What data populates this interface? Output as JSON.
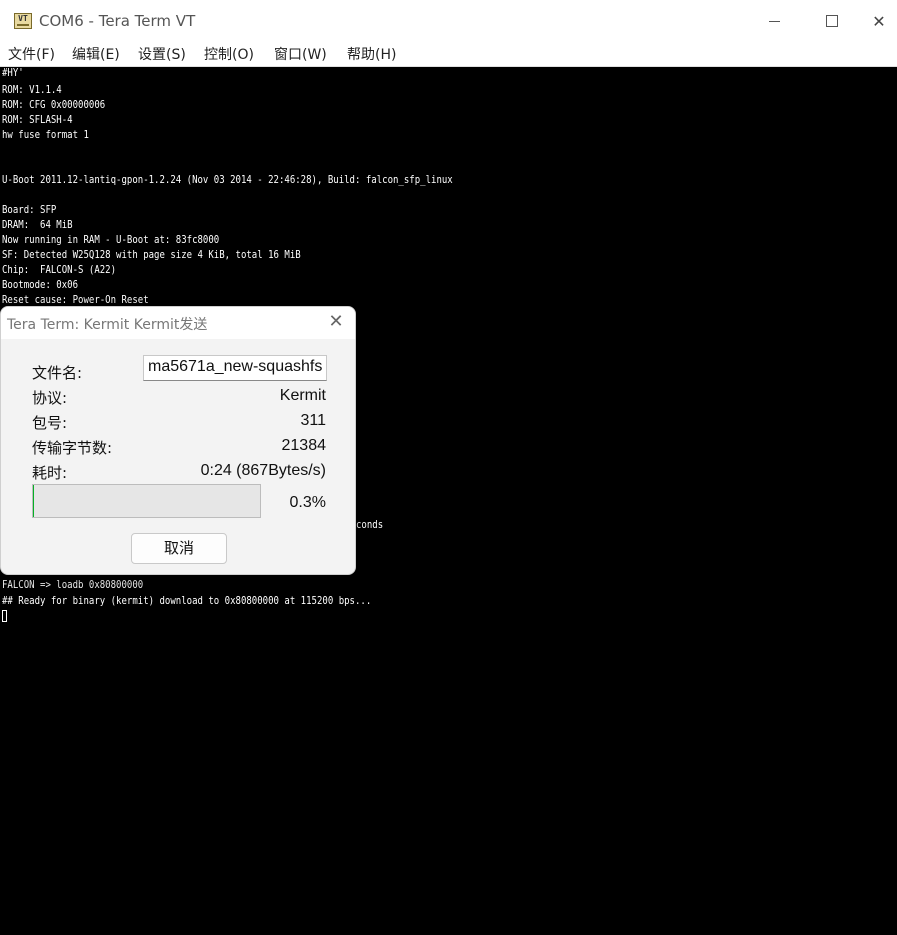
{
  "window": {
    "title": "COM6 - Tera Term VT",
    "icon": "tera-term-icon",
    "controls": {
      "close_glyph": "✕"
    }
  },
  "menu": [
    {
      "label": "文件(F)"
    },
    {
      "label": "编辑(E)"
    },
    {
      "label": "设置(S)"
    },
    {
      "label": "控制(O)"
    },
    {
      "label": "窗口(W)"
    },
    {
      "label": "帮助(H)"
    }
  ],
  "terminal": {
    "lines": [
      "#HY'",
      "ROM: V1.1.4",
      "ROM: CFG 0x00000006",
      "ROM: SFLASH-4",
      "hw fuse format 1",
      "",
      "",
      "U-Boot 2011.12-lantiq-gpon-1.2.24 (Nov 03 2014 - 22:46:28), Build: falcon_sfp_linux",
      "",
      "Board: SFP",
      "DRAM:  64 MiB",
      "Now running in RAM - U-Boot at: 83fc8000",
      "SF: Detected W25Q128 with page size 4 KiB, total 16 MiB",
      "Chip:  FALCON-S (A22)",
      "Bootmode: 0x06",
      "Reset cause: Power-On Reset",
      "conds",
      "FALCON => loadb 0x80800000",
      "## Ready for binary (kermit) download to 0x80800000 at 115200 bps..."
    ]
  },
  "dialog": {
    "title": "Tera Term: Kermit Kermit发送",
    "close_glyph": "✕",
    "fields": {
      "filename_label": "文件名:",
      "filename_value": "ma5671a_new-squashfs",
      "protocol_label": "协议:",
      "protocol_value": "Kermit",
      "packet_label": "包号:",
      "packet_value": "311",
      "bytes_label": "传输字节数:",
      "bytes_value": "21384",
      "time_label": "耗时:",
      "time_value": "0:24 (867Bytes/s)"
    },
    "progress": 0.003,
    "progress_text": "0.3%",
    "cancel_label": "取消"
  }
}
